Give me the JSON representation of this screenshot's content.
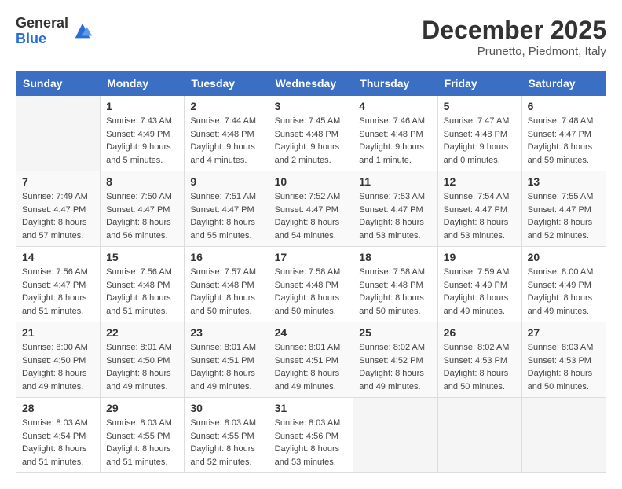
{
  "logo": {
    "general": "General",
    "blue": "Blue"
  },
  "header": {
    "month": "December 2025",
    "location": "Prunetto, Piedmont, Italy"
  },
  "days_of_week": [
    "Sunday",
    "Monday",
    "Tuesday",
    "Wednesday",
    "Thursday",
    "Friday",
    "Saturday"
  ],
  "weeks": [
    [
      {
        "day": "",
        "info": ""
      },
      {
        "day": "1",
        "info": "Sunrise: 7:43 AM\nSunset: 4:49 PM\nDaylight: 9 hours\nand 5 minutes."
      },
      {
        "day": "2",
        "info": "Sunrise: 7:44 AM\nSunset: 4:48 PM\nDaylight: 9 hours\nand 4 minutes."
      },
      {
        "day": "3",
        "info": "Sunrise: 7:45 AM\nSunset: 4:48 PM\nDaylight: 9 hours\nand 2 minutes."
      },
      {
        "day": "4",
        "info": "Sunrise: 7:46 AM\nSunset: 4:48 PM\nDaylight: 9 hours\nand 1 minute."
      },
      {
        "day": "5",
        "info": "Sunrise: 7:47 AM\nSunset: 4:48 PM\nDaylight: 9 hours\nand 0 minutes."
      },
      {
        "day": "6",
        "info": "Sunrise: 7:48 AM\nSunset: 4:47 PM\nDaylight: 8 hours\nand 59 minutes."
      }
    ],
    [
      {
        "day": "7",
        "info": "Sunrise: 7:49 AM\nSunset: 4:47 PM\nDaylight: 8 hours\nand 57 minutes."
      },
      {
        "day": "8",
        "info": "Sunrise: 7:50 AM\nSunset: 4:47 PM\nDaylight: 8 hours\nand 56 minutes."
      },
      {
        "day": "9",
        "info": "Sunrise: 7:51 AM\nSunset: 4:47 PM\nDaylight: 8 hours\nand 55 minutes."
      },
      {
        "day": "10",
        "info": "Sunrise: 7:52 AM\nSunset: 4:47 PM\nDaylight: 8 hours\nand 54 minutes."
      },
      {
        "day": "11",
        "info": "Sunrise: 7:53 AM\nSunset: 4:47 PM\nDaylight: 8 hours\nand 53 minutes."
      },
      {
        "day": "12",
        "info": "Sunrise: 7:54 AM\nSunset: 4:47 PM\nDaylight: 8 hours\nand 53 minutes."
      },
      {
        "day": "13",
        "info": "Sunrise: 7:55 AM\nSunset: 4:47 PM\nDaylight: 8 hours\nand 52 minutes."
      }
    ],
    [
      {
        "day": "14",
        "info": "Sunrise: 7:56 AM\nSunset: 4:47 PM\nDaylight: 8 hours\nand 51 minutes."
      },
      {
        "day": "15",
        "info": "Sunrise: 7:56 AM\nSunset: 4:48 PM\nDaylight: 8 hours\nand 51 minutes."
      },
      {
        "day": "16",
        "info": "Sunrise: 7:57 AM\nSunset: 4:48 PM\nDaylight: 8 hours\nand 50 minutes."
      },
      {
        "day": "17",
        "info": "Sunrise: 7:58 AM\nSunset: 4:48 PM\nDaylight: 8 hours\nand 50 minutes."
      },
      {
        "day": "18",
        "info": "Sunrise: 7:58 AM\nSunset: 4:48 PM\nDaylight: 8 hours\nand 50 minutes."
      },
      {
        "day": "19",
        "info": "Sunrise: 7:59 AM\nSunset: 4:49 PM\nDaylight: 8 hours\nand 49 minutes."
      },
      {
        "day": "20",
        "info": "Sunrise: 8:00 AM\nSunset: 4:49 PM\nDaylight: 8 hours\nand 49 minutes."
      }
    ],
    [
      {
        "day": "21",
        "info": "Sunrise: 8:00 AM\nSunset: 4:50 PM\nDaylight: 8 hours\nand 49 minutes."
      },
      {
        "day": "22",
        "info": "Sunrise: 8:01 AM\nSunset: 4:50 PM\nDaylight: 8 hours\nand 49 minutes."
      },
      {
        "day": "23",
        "info": "Sunrise: 8:01 AM\nSunset: 4:51 PM\nDaylight: 8 hours\nand 49 minutes."
      },
      {
        "day": "24",
        "info": "Sunrise: 8:01 AM\nSunset: 4:51 PM\nDaylight: 8 hours\nand 49 minutes."
      },
      {
        "day": "25",
        "info": "Sunrise: 8:02 AM\nSunset: 4:52 PM\nDaylight: 8 hours\nand 49 minutes."
      },
      {
        "day": "26",
        "info": "Sunrise: 8:02 AM\nSunset: 4:53 PM\nDaylight: 8 hours\nand 50 minutes."
      },
      {
        "day": "27",
        "info": "Sunrise: 8:03 AM\nSunset: 4:53 PM\nDaylight: 8 hours\nand 50 minutes."
      }
    ],
    [
      {
        "day": "28",
        "info": "Sunrise: 8:03 AM\nSunset: 4:54 PM\nDaylight: 8 hours\nand 51 minutes."
      },
      {
        "day": "29",
        "info": "Sunrise: 8:03 AM\nSunset: 4:55 PM\nDaylight: 8 hours\nand 51 minutes."
      },
      {
        "day": "30",
        "info": "Sunrise: 8:03 AM\nSunset: 4:55 PM\nDaylight: 8 hours\nand 52 minutes."
      },
      {
        "day": "31",
        "info": "Sunrise: 8:03 AM\nSunset: 4:56 PM\nDaylight: 8 hours\nand 53 minutes."
      },
      {
        "day": "",
        "info": ""
      },
      {
        "day": "",
        "info": ""
      },
      {
        "day": "",
        "info": ""
      }
    ]
  ]
}
